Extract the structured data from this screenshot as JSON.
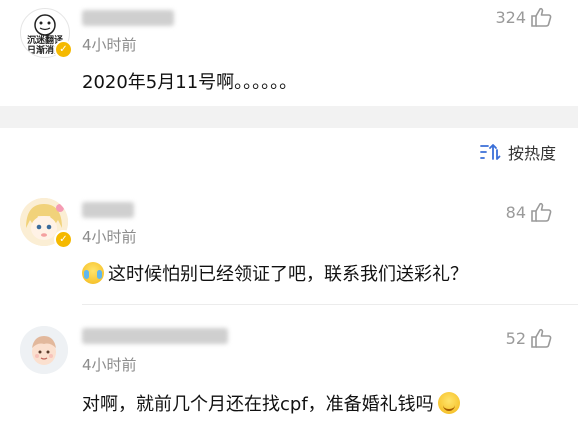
{
  "comments_top": [
    {
      "avatar_text": "沉迷翻译\n日渐消瘦",
      "time": "4小时前",
      "likes": "324",
      "text": "2020年5月11号啊。。。。。。"
    }
  ],
  "sort": {
    "label": "按热度"
  },
  "comments": [
    {
      "time": "4小时前",
      "likes": "84",
      "emoji": "crying-laughing-emoji",
      "text": "这时候怕别已经领证了吧，联系我们送彩礼？"
    },
    {
      "time": "4小时前",
      "likes": "52",
      "emoji": "hugging-emoji",
      "text": "对啊，就前几个月还在找cpf，准备婚礼钱吗"
    }
  ],
  "colors": {
    "verified_badge": "#f5b900",
    "muted_text": "#8c8c8c",
    "divider_bg": "#f2f2f2"
  }
}
